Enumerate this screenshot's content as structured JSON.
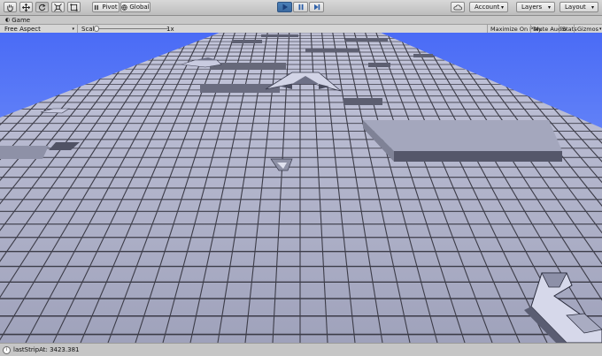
{
  "toolbar": {
    "pivot_label": "Pivot",
    "global_label": "Global",
    "account_label": "Account",
    "layers_label": "Layers",
    "layout_label": "Layout"
  },
  "tab": {
    "title": "Game"
  },
  "game_bar": {
    "aspect_label": "Free Aspect",
    "scale_label": "Scale",
    "scale_value": "1x",
    "maximize_label": "Maximize On Play",
    "mute_label": "Mute Audio",
    "stats_label": "Stats",
    "gizmos_label": "Gizmos"
  },
  "status": {
    "message": "lastStripAt: 3423.381"
  },
  "colors": {
    "sky": "#5a7cf7",
    "floor": "#b8bbd0",
    "grid_line": "#3c3c48",
    "play_active": "#4575ad"
  }
}
